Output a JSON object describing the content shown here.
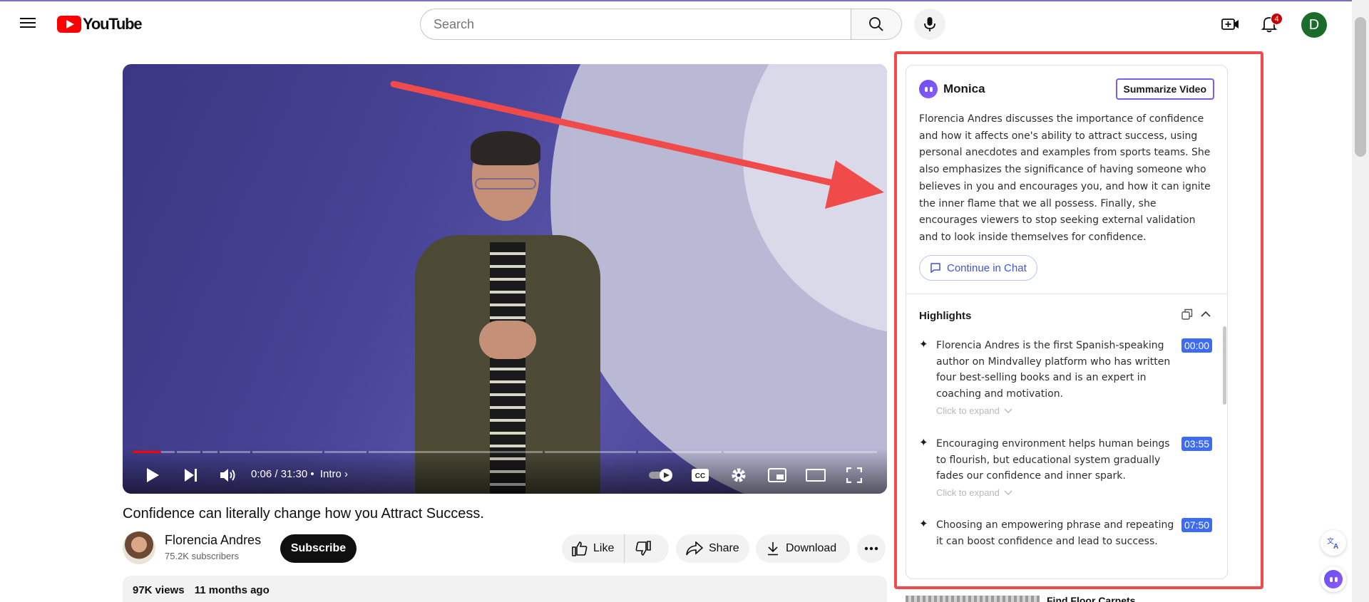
{
  "header": {
    "logo_text": "YouTube",
    "search_placeholder": "Search",
    "notification_count": "4",
    "avatar_initial": "D"
  },
  "player": {
    "time": "0:06 / 31:30",
    "separator": "•",
    "chapter": "Intro",
    "progress_fraction": 0.0032
  },
  "video": {
    "title": "Confidence can literally change how you Attract Success.",
    "channel_name": "Florencia Andres",
    "subscribers": "75.2K subscribers",
    "subscribe_label": "Subscribe",
    "like_label": "Like",
    "share_label": "Share",
    "download_label": "Download",
    "views": "97K views",
    "age": "11 months ago"
  },
  "monica": {
    "title": "Monica",
    "summarize_label": "Summarize Video",
    "summary": "Florencia Andres discusses the importance of confidence and how it affects one's ability to attract success, using personal anecdotes and examples from sports teams. She also emphasizes the significance of having someone who believes in you and encourages you, and how it can ignite the inner flame that we all possess. Finally, she encourages viewers to stop seeking external validation and to look inside themselves for confidence.",
    "continue_label": "Continue in Chat",
    "highlights_title": "Highlights",
    "highlights": [
      {
        "text": "Florencia Andres is the first Spanish-speaking author on Mindvalley platform who has written four best-selling books and is an expert in coaching and motivation.",
        "time": "00:00",
        "expand": "Click to expand"
      },
      {
        "text": "Encouraging environment helps human beings to flourish, but educational system gradually fades our confidence and inner spark.",
        "time": "03:55",
        "expand": "Click to expand"
      },
      {
        "text": "Choosing an empowering phrase and repeating it can boost confidence and lead to success.",
        "time": "07:50"
      }
    ]
  },
  "recommendation": {
    "title": "Find Floor Carpets"
  },
  "colors": {
    "youtube_red": "#ff0000",
    "monica_purple": "#7a5cf2",
    "timestamp_blue": "#3d6cf2",
    "annotation_red": "#f04a4a"
  }
}
